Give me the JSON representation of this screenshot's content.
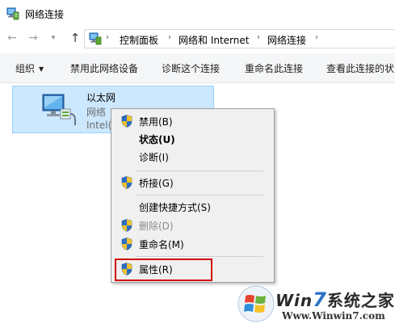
{
  "window": {
    "title": "网络连接"
  },
  "nav": {
    "back_glyph": "←",
    "forward_glyph": "→",
    "dropdown_glyph": "▾",
    "up_glyph": "↑",
    "separator_glyph": "›",
    "breadcrumbs": [
      "控制面板",
      "网络和 Internet",
      "网络连接"
    ]
  },
  "commands": {
    "organize": "组织",
    "disable_device": "禁用此网络设备",
    "diagnose": "诊断这个连接",
    "rename": "重命名此连接",
    "view_status": "查看此连接的状"
  },
  "adapter": {
    "name": "以太网",
    "status": "网络",
    "device": "Intel(R"
  },
  "context_menu": {
    "items": [
      {
        "label": "禁用(B)",
        "shield": true,
        "bold": false,
        "disabled": false
      },
      {
        "label": "状态(U)",
        "shield": false,
        "bold": true,
        "disabled": false
      },
      {
        "label": "诊断(I)",
        "shield": false,
        "bold": false,
        "disabled": false
      },
      {
        "label": "桥接(G)",
        "shield": true,
        "bold": false,
        "disabled": false
      },
      {
        "label": "创建快捷方式(S)",
        "shield": false,
        "bold": false,
        "disabled": false
      },
      {
        "label": "删除(D)",
        "shield": true,
        "bold": false,
        "disabled": true
      },
      {
        "label": "重命名(M)",
        "shield": true,
        "bold": false,
        "disabled": false
      },
      {
        "label": "属性(R)",
        "shield": true,
        "bold": false,
        "disabled": false
      }
    ],
    "highlighted_item": "属性(R)",
    "highlight_color": "#d20000"
  },
  "watermark": {
    "title_prefix": "Win",
    "title_seven": "7",
    "title_suffix": "系统之家",
    "url": "Www.Winwin7.com"
  },
  "colors": {
    "selection_bg": "#cce8ff",
    "selection_border": "#99d1ff",
    "menu_bg": "#f0f0f0",
    "uac_blue": "#2b6fc4",
    "uac_yellow": "#f2c12e"
  }
}
